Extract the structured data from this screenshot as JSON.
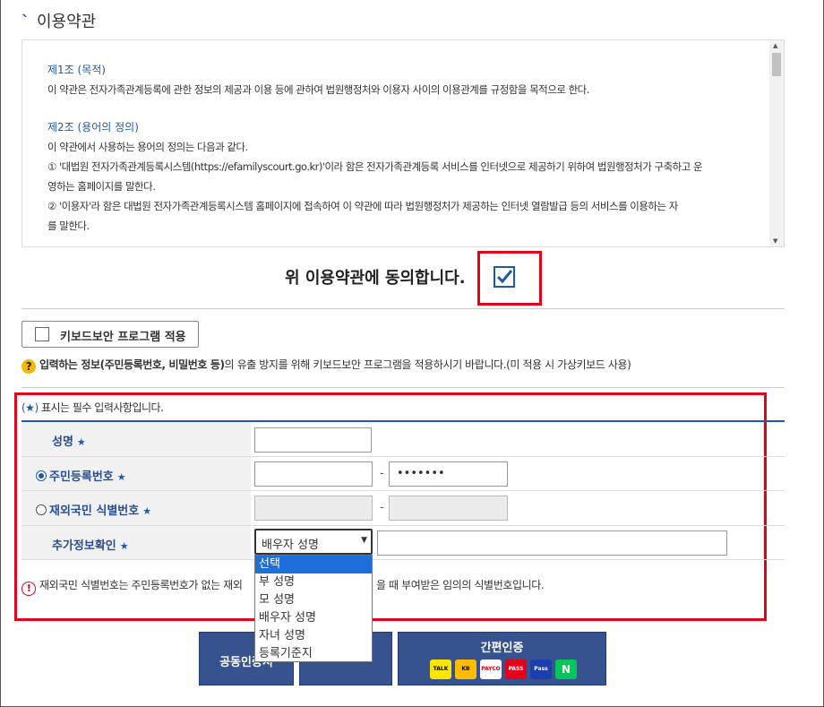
{
  "section_title": "이용약관",
  "terms": {
    "article1_title": "제1조 (목적)",
    "article1_text": "이 약관은 전자가족관계등록에 관한 정보의 제공과 이용 등에 관하여 법원행정처와 이용자 사이의 이용관계를 규정함을 목적으로 한다.",
    "article2_title": "제2조 (용어의 정의)",
    "article2_intro": "이 약관에서 사용하는 용어의 정의는 다음과 같다.",
    "article2_item1_a": "① '대법원 전자가족관계등록시스템(https://efamilyscourt.go.kr)'이라 함은 전자가족관계등록 서비스를 인터넷으로 제공하기 위하여 법원행정처가 구축하고 운",
    "article2_item1_b": "영하는 홈페이지를 말한다.",
    "article2_item2_a": "② '이용자'라 함은 대법원 전자가족관계등록시스템 홈페이지에 접속하여 이 약관에 따라 법원행정처가 제공하는 인터넷 열람발급 등의 서비스를 이용하는 자",
    "article2_item2_b": "를 말한다."
  },
  "agree_text": "위 이용약관에 동의합니다.",
  "agree_checked": true,
  "keyboard": {
    "button_label": "키보드보안 프로그램 적용",
    "notice_bold": "입력하는 정보(주민등록번호, 비밀번호 등)",
    "notice_rest": "의 유출 방지를 위해 키보드보안 프로그램을 적용하시기 바랍니다.(미 적용 시 가상키보드 사용)"
  },
  "form": {
    "required_note_star": "(★)",
    "required_note": "표시는 필수 입력사항입니다.",
    "name_label": "성명",
    "resident_label": "주민등록번호",
    "foreign_label": "재외국민 식별번호",
    "extra_label": "추가정보확인",
    "star": "★",
    "dash": "-",
    "resident_back_masked": "•••••••",
    "select_value": "배우자 성명",
    "options": [
      "선택",
      "부 성명",
      "모 성명",
      "배우자 성명",
      "자녀 성명",
      "등록기준지"
    ]
  },
  "warning": {
    "part1": "재외국민 식별번호는 주민등록번호가 없는 재외",
    "part2": "을 때 부여받은 임의의 식별번호입니다."
  },
  "buttons": {
    "cert": "공동인증서",
    "simple_auth": "간편인증",
    "logos": [
      "TALK",
      "KB",
      "PAYCO",
      "PASS",
      "Pass",
      "N"
    ]
  },
  "colors": {
    "accent": "#1c5aa8",
    "highlight_red": "#e3001b",
    "button_bg": "#36538f",
    "selected_option": "#1e6fd9"
  }
}
